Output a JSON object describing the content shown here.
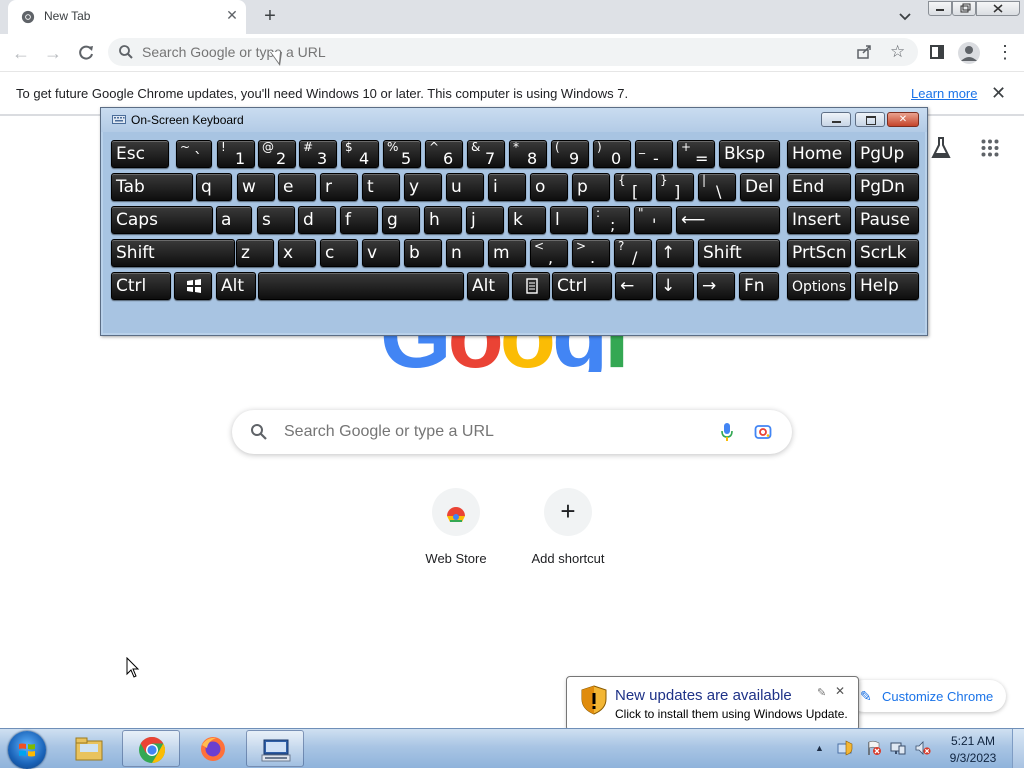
{
  "browser": {
    "tab": {
      "title": "New Tab"
    },
    "omnibox": {
      "placeholder": "Search Google or type a URL"
    }
  },
  "infobar": {
    "message": "To get future Google Chrome updates, you'll need Windows 10 or later. This computer is using Windows 7.",
    "link": "Learn more"
  },
  "ntp": {
    "logo_letters": [
      "G",
      "o",
      "o",
      "g",
      "l",
      "e"
    ],
    "logo_colors": [
      "#4285f4",
      "#ea4335",
      "#fbbc05",
      "#4285f4",
      "#34a853",
      "#ea4335"
    ],
    "search_placeholder": "Search Google or type a URL",
    "shortcuts": [
      {
        "label": "Web Store"
      },
      {
        "label": "Add shortcut"
      }
    ],
    "customize_label": "Customize Chrome"
  },
  "osk": {
    "title": "On-Screen Keyboard",
    "rows": [
      [
        {
          "label": "Esc"
        },
        {
          "top": "~",
          "bot": "`"
        },
        {
          "top": "!",
          "bot": "1"
        },
        {
          "top": "@",
          "bot": "2"
        },
        {
          "top": "#",
          "bot": "3"
        },
        {
          "top": "$",
          "bot": "4"
        },
        {
          "top": "%",
          "bot": "5"
        },
        {
          "top": "^",
          "bot": "6"
        },
        {
          "top": "&",
          "bot": "7"
        },
        {
          "top": "*",
          "bot": "8"
        },
        {
          "top": "(",
          "bot": "9"
        },
        {
          "top": ")",
          "bot": "0"
        },
        {
          "top": "_",
          "bot": "-"
        },
        {
          "top": "+",
          "bot": "="
        },
        {
          "label": "Bksp"
        },
        {
          "label": "Home"
        },
        {
          "label": "PgUp"
        }
      ],
      [
        {
          "label": "Tab"
        },
        {
          "label": "q"
        },
        {
          "label": "w"
        },
        {
          "label": "e"
        },
        {
          "label": "r"
        },
        {
          "label": "t"
        },
        {
          "label": "y"
        },
        {
          "label": "u"
        },
        {
          "label": "i"
        },
        {
          "label": "o"
        },
        {
          "label": "p"
        },
        {
          "top": "{",
          "bot": "["
        },
        {
          "top": "}",
          "bot": "]"
        },
        {
          "top": "|",
          "bot": "\\"
        },
        {
          "label": "Del"
        },
        {
          "label": "End"
        },
        {
          "label": "PgDn"
        }
      ],
      [
        {
          "label": "Caps"
        },
        {
          "label": "a"
        },
        {
          "label": "s"
        },
        {
          "label": "d"
        },
        {
          "label": "f"
        },
        {
          "label": "g"
        },
        {
          "label": "h"
        },
        {
          "label": "j"
        },
        {
          "label": "k"
        },
        {
          "label": "l"
        },
        {
          "top": ":",
          "bot": ";"
        },
        {
          "top": "\"",
          "bot": "'"
        },
        {
          "label": "⟵"
        },
        {
          "label": "Insert"
        },
        {
          "label": "Pause"
        }
      ],
      [
        {
          "label": "Shift"
        },
        {
          "label": "z"
        },
        {
          "label": "x"
        },
        {
          "label": "c"
        },
        {
          "label": "v"
        },
        {
          "label": "b"
        },
        {
          "label": "n"
        },
        {
          "label": "m"
        },
        {
          "top": "<",
          "bot": ","
        },
        {
          "top": ">",
          "bot": "."
        },
        {
          "top": "?",
          "bot": "/"
        },
        {
          "label": "↑"
        },
        {
          "label": "Shift"
        },
        {
          "label": "PrtScn"
        },
        {
          "label": "ScrLk"
        }
      ],
      [
        {
          "label": "Ctrl"
        },
        {
          "label": "windows-logo-icon",
          "icon": true
        },
        {
          "label": "Alt"
        },
        {
          "label": ""
        },
        {
          "label": "Alt"
        },
        {
          "label": "menu-key-icon",
          "icon": true
        },
        {
          "label": "Ctrl"
        },
        {
          "label": "←"
        },
        {
          "label": "↓"
        },
        {
          "label": "→"
        },
        {
          "label": "Fn"
        },
        {
          "label": "Options"
        },
        {
          "label": "Help"
        }
      ]
    ]
  },
  "balloon": {
    "title": "New updates are available",
    "text": "Click to install them using Windows Update."
  },
  "taskbar": {
    "apps": [
      "explorer-icon",
      "chrome-icon",
      "firefox-icon",
      "on-screen-keyboard-icon"
    ],
    "active": "chrome-icon",
    "time": "5:21 AM",
    "date": "9/3/2023"
  }
}
